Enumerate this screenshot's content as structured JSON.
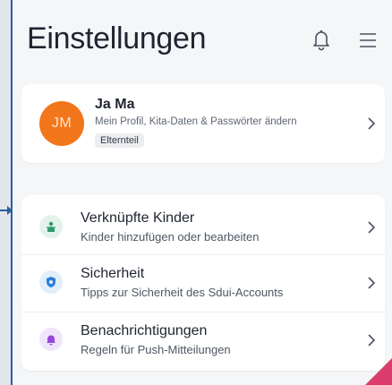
{
  "header": {
    "title": "Einstellungen",
    "icons": [
      "bell-icon",
      "menu-icon"
    ]
  },
  "profile": {
    "initials": "JM",
    "name": "Ja Ma",
    "subtitle": "Mein Profil, Kita-Daten & Passwörter ändern",
    "badge": "Elternteil",
    "avatar_color": "#f2761c"
  },
  "settings": [
    {
      "title": "Verknüpfte Kinder",
      "subtitle": "Kinder hinzufügen oder bearbeiten",
      "icon": "child-icon",
      "icon_bg": "#e3f3ec",
      "icon_color": "#2e9b6c"
    },
    {
      "title": "Sicherheit",
      "subtitle": "Tipps zur Sicherheit des Sdui-Accounts",
      "icon": "shield-icon",
      "icon_bg": "#e2eefa",
      "icon_color": "#2f7fd6"
    },
    {
      "title": "Benachrichtigungen",
      "subtitle": "Regeln für Push-Mitteilungen",
      "icon": "notification-bell-icon",
      "icon_bg": "#efe5fb",
      "icon_color": "#9548d9"
    }
  ],
  "colors": {
    "background": "#f5f6f8",
    "card": "#ffffff",
    "text": "#1f2430",
    "accent_corner": "#dc3d6e",
    "annotation_arrow": "#2b5f9e"
  }
}
